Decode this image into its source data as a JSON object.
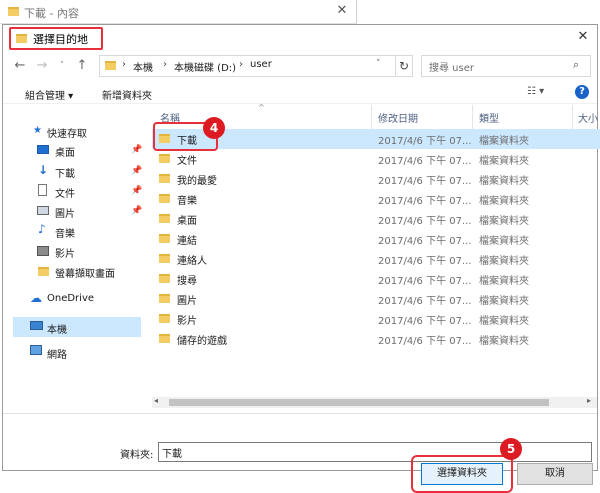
{
  "background_window": {
    "title": "下載 - 內容",
    "close_icon": "✕"
  },
  "dialog": {
    "title": "選擇目的地",
    "close_icon": "✕"
  },
  "address_bar": {
    "back_icon": "←",
    "forward_icon": "→",
    "recent_icon": "˅",
    "up_icon": "↑",
    "breadcrumb": [
      "本機",
      "本機磁碟 (D:)",
      "user"
    ],
    "refresh_icon": "↻",
    "search_placeholder": "搜尋 user",
    "search_icon": "🔍"
  },
  "toolbar": {
    "organize_label": "組合管理 ▾",
    "new_folder_label": "新增資料夾",
    "view_icon": "☷ ▾",
    "help_icon": "?"
  },
  "nav": {
    "quick_access": "快速存取",
    "items": [
      "桌面",
      "下載",
      "文件",
      "圖片",
      "音樂",
      "影片",
      "螢幕擷取畫面"
    ],
    "onedrive": "OneDrive",
    "this_pc": "本機",
    "network": "網路"
  },
  "columns": {
    "name": "名稱",
    "modified": "修改日期",
    "type": "類型",
    "size": "大小"
  },
  "files": [
    {
      "name": "下載",
      "modified": "2017/4/6 下午 07...",
      "type": "檔案資料夾"
    },
    {
      "name": "文件",
      "modified": "2017/4/6 下午 07...",
      "type": "檔案資料夾"
    },
    {
      "name": "我的最愛",
      "modified": "2017/4/6 下午 07...",
      "type": "檔案資料夾"
    },
    {
      "name": "音樂",
      "modified": "2017/4/6 下午 07...",
      "type": "檔案資料夾"
    },
    {
      "name": "桌面",
      "modified": "2017/4/6 下午 07...",
      "type": "檔案資料夾"
    },
    {
      "name": "連結",
      "modified": "2017/4/6 下午 07...",
      "type": "檔案資料夾"
    },
    {
      "name": "連絡人",
      "modified": "2017/4/6 下午 07...",
      "type": "檔案資料夾"
    },
    {
      "name": "搜尋",
      "modified": "2017/4/6 下午 07...",
      "type": "檔案資料夾"
    },
    {
      "name": "圖片",
      "modified": "2017/4/6 下午 07...",
      "type": "檔案資料夾"
    },
    {
      "name": "影片",
      "modified": "2017/4/6 下午 07...",
      "type": "檔案資料夾"
    },
    {
      "name": "儲存的遊戲",
      "modified": "2017/4/6 下午 07...",
      "type": "檔案資料夾"
    }
  ],
  "folder_field": {
    "label": "資料夾:",
    "value": "下載"
  },
  "buttons": {
    "ok": "選擇資料夾",
    "cancel": "取消"
  },
  "annotations": {
    "step4": "4",
    "step5": "5"
  }
}
